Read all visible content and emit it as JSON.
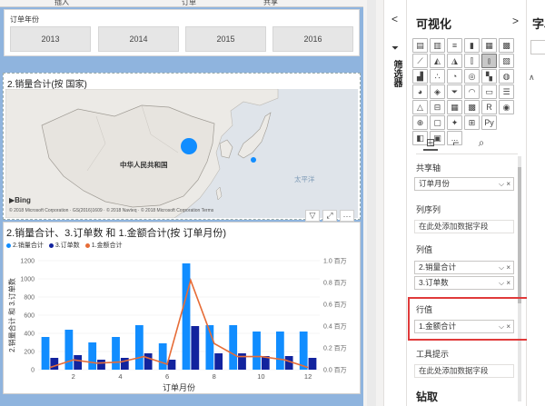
{
  "top_strip": {
    "labels": [
      "插入",
      "订单",
      "共享"
    ]
  },
  "slicer": {
    "title": "订单年份",
    "years": [
      "2013",
      "2014",
      "2015",
      "2016"
    ]
  },
  "map_visual": {
    "title": "2.销量合计(按 国家)",
    "country_label": "中华人民共和国",
    "sea_label": "太平洋",
    "bing_label": "Bing",
    "copyright": "© 2018 Microsoft Corporation · GS(2016)1609 · © 2018 Navteq · © 2018 Microsoft Corporation  Terms"
  },
  "visual_header": {
    "filter_icon": "filter-icon",
    "focus_icon": "focus-mode-icon",
    "more_label": "···"
  },
  "combo_visual": {
    "title": "2.销量合计、3.订单数 和 1.金额合计(按 订单月份)",
    "legend": [
      {
        "label": "2.销量合计",
        "color": "#118dff"
      },
      {
        "label": "3.订单数",
        "color": "#12239e"
      },
      {
        "label": "1.金额合计",
        "color": "#e66c37"
      }
    ],
    "xlabel": "订单月份",
    "ylabel_left": "2.销量合计 和 3.订单数",
    "left_ticks": [
      "0",
      "200",
      "400",
      "600",
      "800",
      "1000",
      "1200"
    ],
    "right_ticks": [
      "0.0 百万",
      "0.2 百万",
      "0.4 百万",
      "0.6 百万",
      "0.8 百万",
      "1.0 百万"
    ],
    "x_ticks": [
      "2",
      "4",
      "6",
      "8",
      "10",
      "12"
    ]
  },
  "chart_data": {
    "type": "bar",
    "title": "2.销量合计、3.订单数 和 1.金额合计(按 订单月份)",
    "xlabel": "订单月份",
    "ylabel": "2.销量合计 和 3.订单数",
    "categories": [
      "1",
      "2",
      "3",
      "4",
      "5",
      "6",
      "7",
      "8",
      "9",
      "10",
      "11",
      "12"
    ],
    "ylim": [
      0,
      1200
    ],
    "y2lim": [
      0,
      1.0
    ],
    "series": [
      {
        "name": "2.销量合计",
        "type": "bar",
        "axis": "left",
        "color": "#118dff",
        "values": [
          360,
          440,
          300,
          360,
          490,
          290,
          1170,
          490,
          490,
          420,
          420,
          420
        ]
      },
      {
        "name": "3.订单数",
        "type": "bar",
        "axis": "left",
        "color": "#12239e",
        "values": [
          130,
          160,
          110,
          130,
          180,
          110,
          480,
          180,
          180,
          150,
          150,
          130
        ]
      },
      {
        "name": "1.金额合计",
        "type": "line",
        "axis": "right",
        "color": "#e66c37",
        "values": [
          0.02,
          0.09,
          0.06,
          0.07,
          0.12,
          0.05,
          0.82,
          0.24,
          0.12,
          0.12,
          0.09,
          0.02
        ]
      }
    ]
  },
  "filter_pane": {
    "label": "筛选器",
    "chevron": "<"
  },
  "viz_pane": {
    "title": "可视化",
    "chevron": ">",
    "sections": {
      "shared_axis": "共享轴",
      "col_series": "列序列",
      "col_values": "列值",
      "row_values": "行值",
      "tooltips": "工具提示",
      "drillthrough": "钻取"
    },
    "wells": {
      "shared_axis_field": "订单月份",
      "col_series_placeholder": "在此处添加数据字段",
      "col_values_fields": [
        "2.销量合计",
        "3.订单数"
      ],
      "row_values_field": "1.金额合计",
      "tooltips_placeholder": "在此处添加数据字段"
    },
    "well_actions": "⌵ ×",
    "icon_row_extra": [
      "R",
      "Py",
      "..."
    ]
  },
  "fields_pane": {
    "title": "字段"
  }
}
